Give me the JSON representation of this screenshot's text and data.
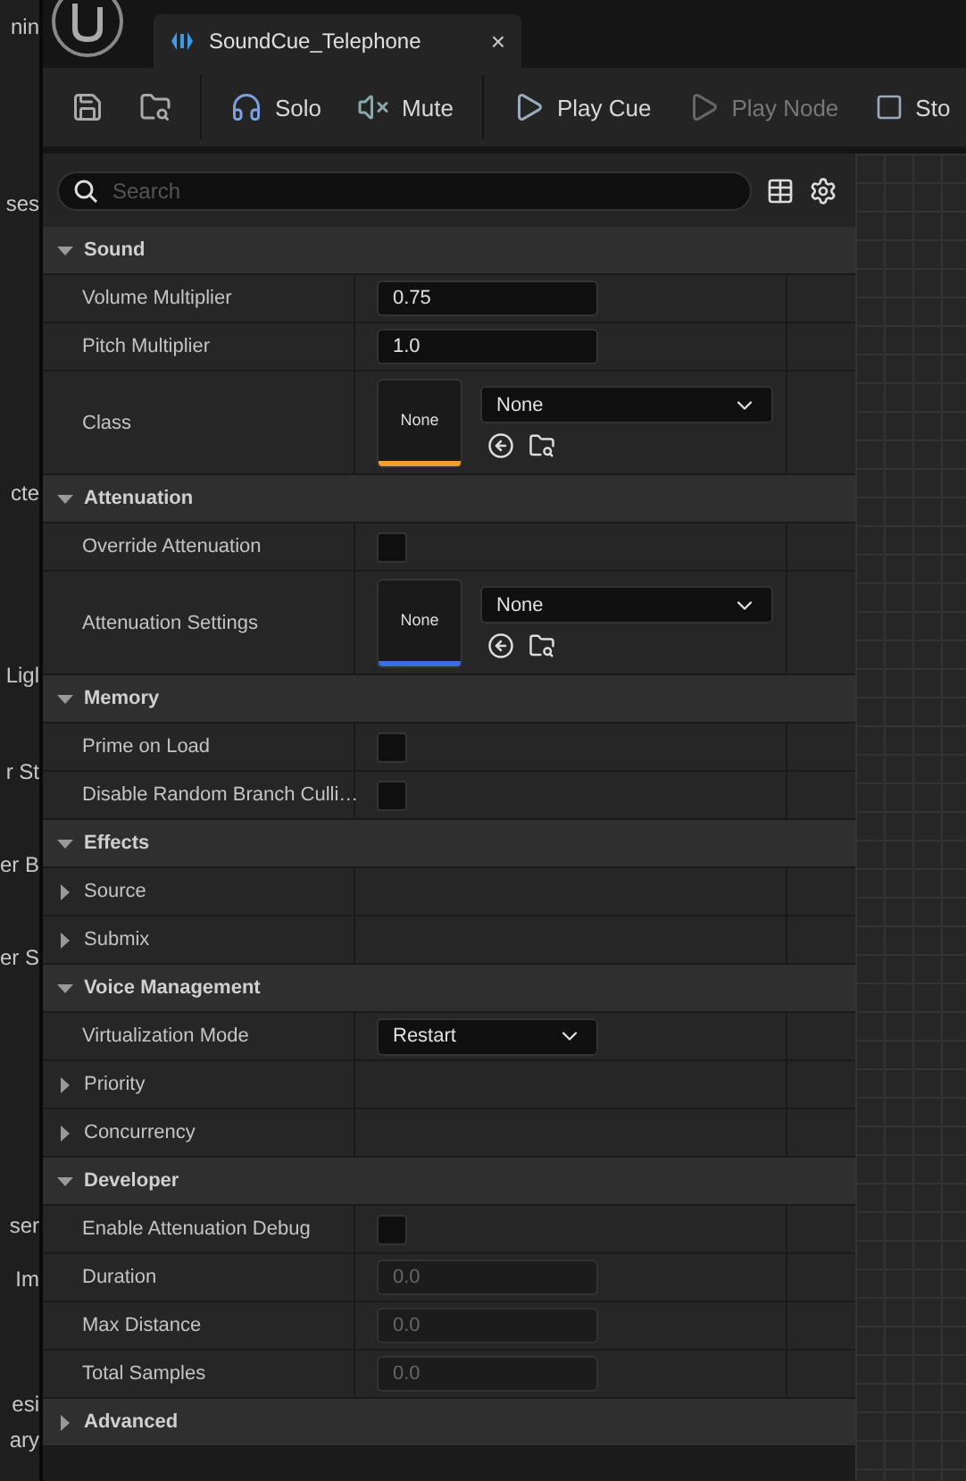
{
  "left_strip": [
    "nin",
    "ses",
    "cte",
    "Ligl",
    "r St",
    "er B",
    "er S",
    "ser",
    "Im",
    "esi",
    "ary"
  ],
  "tab": {
    "title": "SoundCue_Telephone",
    "close": "×",
    "selected": true
  },
  "toolbar": [
    {
      "kind": "save"
    },
    {
      "kind": "browse"
    },
    {
      "kind": "solo",
      "label": "Solo"
    },
    {
      "kind": "mute",
      "label": "Mute"
    },
    {
      "kind": "play",
      "label": "Play Cue",
      "disabled": false
    },
    {
      "kind": "play",
      "label": "Play Node",
      "disabled": true
    },
    {
      "kind": "stop",
      "label": "Sto"
    }
  ],
  "details": {
    "search": {
      "placeholder": "Search"
    },
    "sections": [
      {
        "title": "Sound",
        "expanded": true,
        "rows": [
          {
            "kind": "number",
            "label": "Volume Multiplier",
            "value": "0.75",
            "disabled": false
          },
          {
            "kind": "number",
            "label": "Pitch Multiplier",
            "value": "1.0",
            "disabled": false
          },
          {
            "kind": "object",
            "label": "Class",
            "thumb": "None",
            "value": "None",
            "color": "#f0a030"
          }
        ]
      },
      {
        "title": "Attenuation",
        "expanded": true,
        "rows": [
          {
            "kind": "checkbox",
            "label": "Override Attenuation",
            "checked": false
          },
          {
            "kind": "object",
            "label": "Attenuation Settings",
            "thumb": "None",
            "value": "None",
            "color": "#3a6ee0"
          }
        ]
      },
      {
        "title": "Memory",
        "expanded": true,
        "rows": [
          {
            "kind": "checkbox",
            "label": "Prime on Load",
            "checked": false
          },
          {
            "kind": "checkbox",
            "label": "Disable Random Branch Culli…",
            "checked": false
          }
        ]
      },
      {
        "title": "Effects",
        "expanded": true,
        "rows": [
          {
            "kind": "group",
            "label": "Source",
            "expanded": false
          },
          {
            "kind": "group",
            "label": "Submix",
            "expanded": false
          }
        ]
      },
      {
        "title": "Voice Management",
        "expanded": true,
        "rows": [
          {
            "kind": "dropdown",
            "label": "Virtualization Mode",
            "value": "Restart"
          },
          {
            "kind": "group",
            "label": "Priority",
            "expanded": false
          },
          {
            "kind": "group",
            "label": "Concurrency",
            "expanded": false
          }
        ]
      },
      {
        "title": "Developer",
        "expanded": true,
        "rows": [
          {
            "kind": "checkbox",
            "label": "Enable Attenuation Debug",
            "checked": false
          },
          {
            "kind": "number",
            "label": "Duration",
            "value": "0.0",
            "disabled": true
          },
          {
            "kind": "number",
            "label": "Max Distance",
            "value": "0.0",
            "disabled": true
          },
          {
            "kind": "number",
            "label": "Total Samples",
            "value": "0.0",
            "disabled": true
          }
        ]
      },
      {
        "title": "Advanced",
        "expanded": false
      }
    ]
  }
}
